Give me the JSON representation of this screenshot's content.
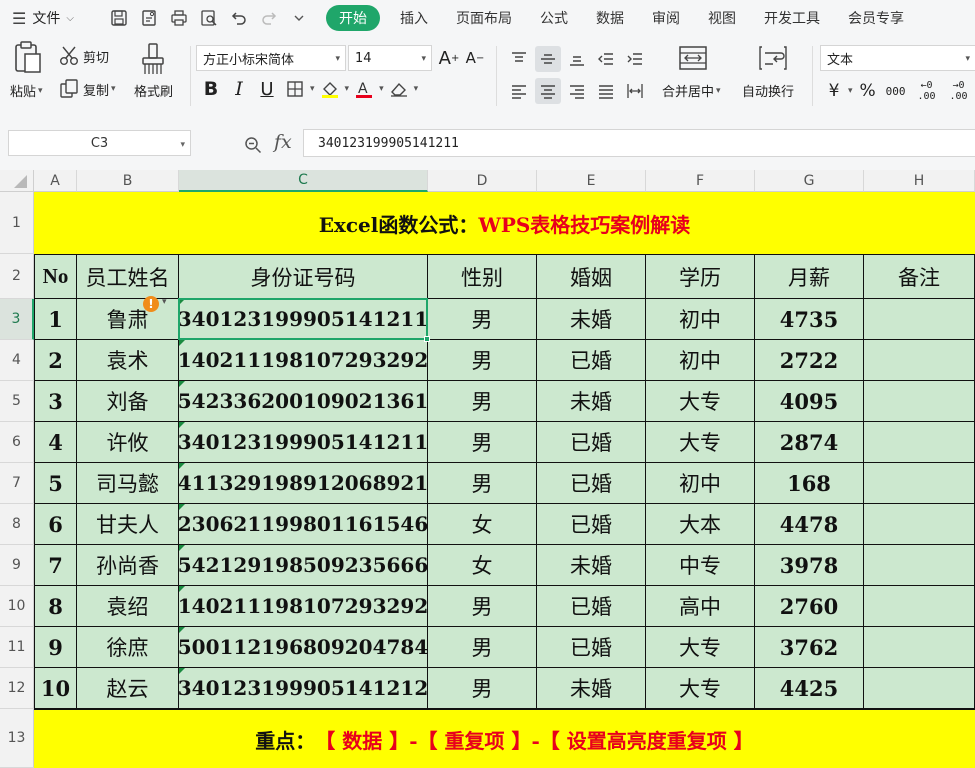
{
  "menu": {
    "file_label": "文件",
    "tabs": [
      {
        "label": "开始",
        "active": true
      },
      {
        "label": "插入"
      },
      {
        "label": "页面布局"
      },
      {
        "label": "公式"
      },
      {
        "label": "数据"
      },
      {
        "label": "审阅"
      },
      {
        "label": "视图"
      },
      {
        "label": "开发工具"
      },
      {
        "label": "会员专享"
      }
    ]
  },
  "ribbon": {
    "paste_label": "粘贴",
    "cut_label": "剪切",
    "copy_label": "复制",
    "format_painter_label": "格式刷",
    "font_name": "方正小标宋简体",
    "font_size": "14",
    "merge_center_label": "合并居中",
    "wrap_text_label": "自动换行",
    "number_format": "文本",
    "currency_symbol": "¥",
    "percent_symbol": "%",
    "thousands_symbol": "000",
    "inc_decimal_symbol": ".00",
    "dec_decimal_symbol": ".00"
  },
  "formula_bar": {
    "name_box": "C3",
    "fx_label": "fx",
    "value": "340123199905141211"
  },
  "sheet": {
    "columns": [
      "A",
      "B",
      "C",
      "D",
      "E",
      "F",
      "G",
      "H"
    ],
    "active_column": "C",
    "rows": [
      "1",
      "2",
      "3",
      "4",
      "5",
      "6",
      "7",
      "8",
      "9",
      "10",
      "11",
      "12",
      "13"
    ],
    "active_row": "3",
    "title_black": "Excel函数公式：",
    "title_red": "WPS表格技巧案例解读",
    "headers": [
      "No",
      "员工姓名",
      "身份证号码",
      "性别",
      "婚姻",
      "学历",
      "月薪",
      "备注"
    ],
    "records": [
      {
        "no": "1",
        "name": "鲁肃",
        "id": "340123199905141211",
        "gender": "男",
        "marital": "未婚",
        "edu": "初中",
        "salary": "4735"
      },
      {
        "no": "2",
        "name": "袁术",
        "id": "140211198107293292",
        "gender": "男",
        "marital": "已婚",
        "edu": "初中",
        "salary": "2722"
      },
      {
        "no": "3",
        "name": "刘备",
        "id": "542336200109021361",
        "gender": "男",
        "marital": "未婚",
        "edu": "大专",
        "salary": "4095"
      },
      {
        "no": "4",
        "name": "许攸",
        "id": "340123199905141211",
        "gender": "男",
        "marital": "已婚",
        "edu": "大专",
        "salary": "2874"
      },
      {
        "no": "5",
        "name": "司马懿",
        "id": "411329198912068921",
        "gender": "男",
        "marital": "已婚",
        "edu": "初中",
        "salary": "168"
      },
      {
        "no": "6",
        "name": "甘夫人",
        "id": "230621199801161546",
        "gender": "女",
        "marital": "已婚",
        "edu": "大本",
        "salary": "4478"
      },
      {
        "no": "7",
        "name": "孙尚香",
        "id": "542129198509235666",
        "gender": "女",
        "marital": "未婚",
        "edu": "中专",
        "salary": "3978"
      },
      {
        "no": "8",
        "name": "袁绍",
        "id": "140211198107293292",
        "gender": "男",
        "marital": "已婚",
        "edu": "高中",
        "salary": "2760"
      },
      {
        "no": "9",
        "name": "徐庶",
        "id": "500112196809204784",
        "gender": "男",
        "marital": "已婚",
        "edu": "大专",
        "salary": "3762"
      },
      {
        "no": "10",
        "name": "赵云",
        "id": "340123199905141212",
        "gender": "男",
        "marital": "未婚",
        "edu": "大专",
        "salary": "4425"
      }
    ],
    "footer_black": "重点：",
    "footer_red": "【 数据 】-【 重复项 】-【 设置高亮度重复项 】"
  },
  "colors": {
    "accent_green": "#1fa66a",
    "cell_fill": "#cce8cf",
    "title_fill": "#ffff00",
    "title_red": "#e8001c",
    "warning_orange": "#f08c1a"
  }
}
